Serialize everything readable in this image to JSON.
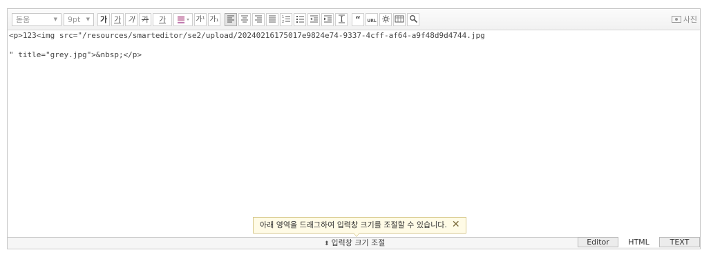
{
  "toolbar": {
    "font_family": "돋움",
    "font_size": "9pt",
    "bold": "가",
    "underline": "가",
    "italic": "가",
    "strikethrough": "가",
    "font_color": "가",
    "superscript": "가¹",
    "subscript": "가₁",
    "url_label": "URL",
    "photo_label": "사진"
  },
  "source": {
    "line1": "<p>123<img src=\"/resources/smarteditor/se2/upload/20240216175017e9824e74-9337-4cff-af64-a9f48d9d4744.jpg",
    "line2": "\" title=\"grey.jpg\">&nbsp;</p>"
  },
  "hint": {
    "text": "아래 영역을 드래그하여 입력창 크기를 조절할 수 있습니다."
  },
  "bottom_bar": {
    "resize_label": "입력창 크기 조절",
    "modes": [
      "Editor",
      "HTML",
      "TEXT"
    ],
    "active_mode": "HTML"
  }
}
